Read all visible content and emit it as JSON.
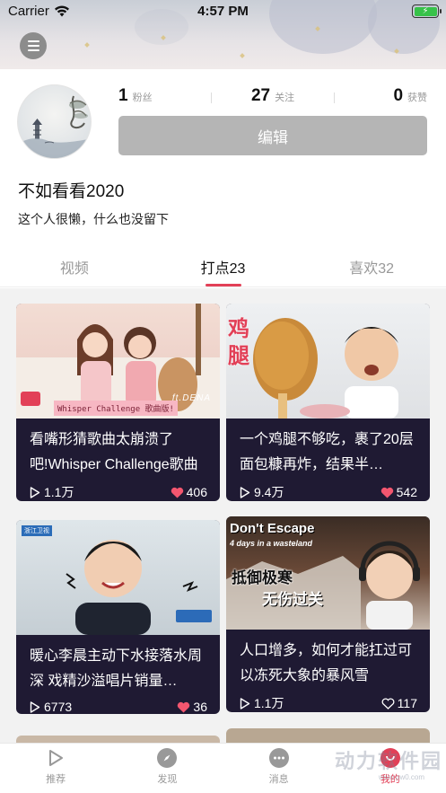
{
  "status_bar": {
    "carrier": "Carrier",
    "time": "4:57 PM",
    "battery_level": 1.0
  },
  "profile": {
    "stats": [
      {
        "value": "1",
        "label": "粉丝"
      },
      {
        "value": "27",
        "label": "关注"
      },
      {
        "value": "0",
        "label": "获赞"
      }
    ],
    "edit_label": "编辑",
    "username": "不如看看2020",
    "bio": "这个人很懒，什么也没留下"
  },
  "tabs": [
    {
      "label": "视频",
      "active": false
    },
    {
      "label": "打点23",
      "active": true
    },
    {
      "label": "喜欢32",
      "active": false
    }
  ],
  "cards": [
    {
      "title": "看嘴形猜歌曲太崩溃了吧!Whisper Challenge歌曲版",
      "plays": "1.1万",
      "likes": "406",
      "liked": true,
      "thumb_caption": "Whisper Challenge 歌曲版!",
      "thumb_tag": "ft.DENA"
    },
    {
      "title": "一个鸡腿不够吃，裹了20层面包糠再炸，结果半…",
      "plays": "9.4万",
      "likes": "542",
      "liked": true,
      "thumb_caption": "鸡腿"
    },
    {
      "title": "暖心李晨主动下水接落水周深 戏精沙溢唱片销量…",
      "plays": "6773",
      "likes": "36",
      "liked": true,
      "thumb_caption": "浙江卫视"
    },
    {
      "title": "人口增多，如何才能扛过可以冻死大象的暴风雪",
      "plays": "1.1万",
      "likes": "117",
      "liked": false,
      "thumb_caption": "Don't Escape",
      "thumb_sub": "4 days in a wasteland",
      "thumb_cn": "抵御极寒",
      "thumb_cn2": "无伤过关"
    }
  ],
  "tabbar": [
    {
      "label": "推荐",
      "icon": "play-icon",
      "active": false
    },
    {
      "label": "发现",
      "icon": "compass-icon",
      "active": false
    },
    {
      "label": "消息",
      "icon": "message-icon",
      "active": false
    },
    {
      "label": "我的",
      "icon": "profile-icon",
      "active": true
    }
  ],
  "watermark": {
    "text": "动力软件园",
    "url": "www.pw0.com"
  },
  "colors": {
    "accent": "#e24057",
    "card_bg": "#1f1a33",
    "edit_button": "#b5b5b5"
  }
}
